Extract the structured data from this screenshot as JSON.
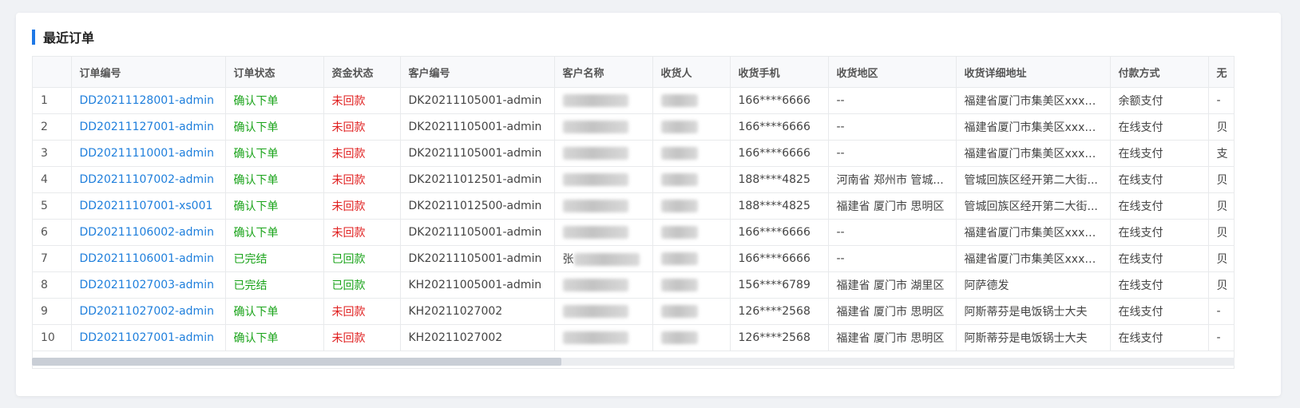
{
  "card": {
    "title": "最近订单"
  },
  "columns": [
    "",
    "订单编号",
    "订单状态",
    "资金状态",
    "客户编号",
    "客户名称",
    "收货人",
    "收货手机",
    "收货地区",
    "收货详细地址",
    "付款方式",
    "无"
  ],
  "rows": [
    {
      "index": "1",
      "order_no": "DD20211128001-admin",
      "order_status": "确认下单",
      "order_status_type": "confirm",
      "fund_status": "未回款",
      "fund_status_type": "unpaid",
      "customer_no": "DK20211105001-admin",
      "customer_name": "",
      "receiver": "",
      "phone": "166****6666",
      "region": "--",
      "address": "福建省厦门市集美区xxx路...",
      "payment": "余额支付",
      "extra": "-"
    },
    {
      "index": "2",
      "order_no": "DD20211127001-admin",
      "order_status": "确认下单",
      "order_status_type": "confirm",
      "fund_status": "未回款",
      "fund_status_type": "unpaid",
      "customer_no": "DK20211105001-admin",
      "customer_name": "",
      "receiver": "",
      "phone": "166****6666",
      "region": "--",
      "address": "福建省厦门市集美区xxx路...",
      "payment": "在线支付",
      "extra": "贝"
    },
    {
      "index": "3",
      "order_no": "DD20211110001-admin",
      "order_status": "确认下单",
      "order_status_type": "confirm",
      "fund_status": "未回款",
      "fund_status_type": "unpaid",
      "customer_no": "DK20211105001-admin",
      "customer_name": "",
      "receiver": "",
      "phone": "166****6666",
      "region": "--",
      "address": "福建省厦门市集美区xxx路...",
      "payment": "在线支付",
      "extra": "支"
    },
    {
      "index": "4",
      "order_no": "DD20211107002-admin",
      "order_status": "确认下单",
      "order_status_type": "confirm",
      "fund_status": "未回款",
      "fund_status_type": "unpaid",
      "customer_no": "DK20211012501-admin",
      "customer_name": "",
      "receiver": "",
      "phone": "188****4825",
      "region": "河南省 郑州市 管城...",
      "address": "管城回族区经开第二大街...",
      "payment": "在线支付",
      "extra": "贝"
    },
    {
      "index": "5",
      "order_no": "DD20211107001-xs001",
      "order_status": "确认下单",
      "order_status_type": "confirm",
      "fund_status": "未回款",
      "fund_status_type": "unpaid",
      "customer_no": "DK20211012500-admin",
      "customer_name": "",
      "receiver": "",
      "phone": "188****4825",
      "region": "福建省 厦门市 思明区",
      "address": "管城回族区经开第二大街...",
      "payment": "在线支付",
      "extra": "贝"
    },
    {
      "index": "6",
      "order_no": "DD20211106002-admin",
      "order_status": "确认下单",
      "order_status_type": "confirm",
      "fund_status": "未回款",
      "fund_status_type": "unpaid",
      "customer_no": "DK20211105001-admin",
      "customer_name": "",
      "receiver": "",
      "phone": "166****6666",
      "region": "--",
      "address": "福建省厦门市集美区xxx路...",
      "payment": "在线支付",
      "extra": "贝"
    },
    {
      "index": "7",
      "order_no": "DD20211106001-admin",
      "order_status": "已完结",
      "order_status_type": "done",
      "fund_status": "已回款",
      "fund_status_type": "paid",
      "customer_no": "DK20211105001-admin",
      "customer_name": "张",
      "receiver": "",
      "phone": "166****6666",
      "region": "--",
      "address": "福建省厦门市集美区xxx路...",
      "payment": "在线支付",
      "extra": "贝"
    },
    {
      "index": "8",
      "order_no": "DD20211027003-admin",
      "order_status": "已完结",
      "order_status_type": "done",
      "fund_status": "已回款",
      "fund_status_type": "paid",
      "customer_no": "KH20211005001-admin",
      "customer_name": "",
      "receiver": "",
      "phone": "156****6789",
      "region": "福建省 厦门市 湖里区",
      "address": "阿萨德发",
      "payment": "在线支付",
      "extra": "贝"
    },
    {
      "index": "9",
      "order_no": "DD20211027002-admin",
      "order_status": "确认下单",
      "order_status_type": "confirm",
      "fund_status": "未回款",
      "fund_status_type": "unpaid",
      "customer_no": "KH20211027002",
      "customer_name": "",
      "receiver": "",
      "phone": "126****2568",
      "region": "福建省 厦门市 思明区",
      "address": "阿斯蒂芬是电饭锅士大夫",
      "payment": "在线支付",
      "extra": "-"
    },
    {
      "index": "10",
      "order_no": "DD20211027001-admin",
      "order_status": "确认下单",
      "order_status_type": "confirm",
      "fund_status": "未回款",
      "fund_status_type": "unpaid",
      "customer_no": "KH20211027002",
      "customer_name": "",
      "receiver": "",
      "phone": "126****2568",
      "region": "福建省 厦门市 思明区",
      "address": "阿斯蒂芬是电饭锅士大夫",
      "payment": "在线支付",
      "extra": "-"
    }
  ],
  "colors": {
    "accent": "#1e78e6",
    "link": "#1f7fdc",
    "success": "#19a319",
    "danger": "#e02020"
  },
  "scrollbar": {
    "thumb_fraction": 0.44
  }
}
